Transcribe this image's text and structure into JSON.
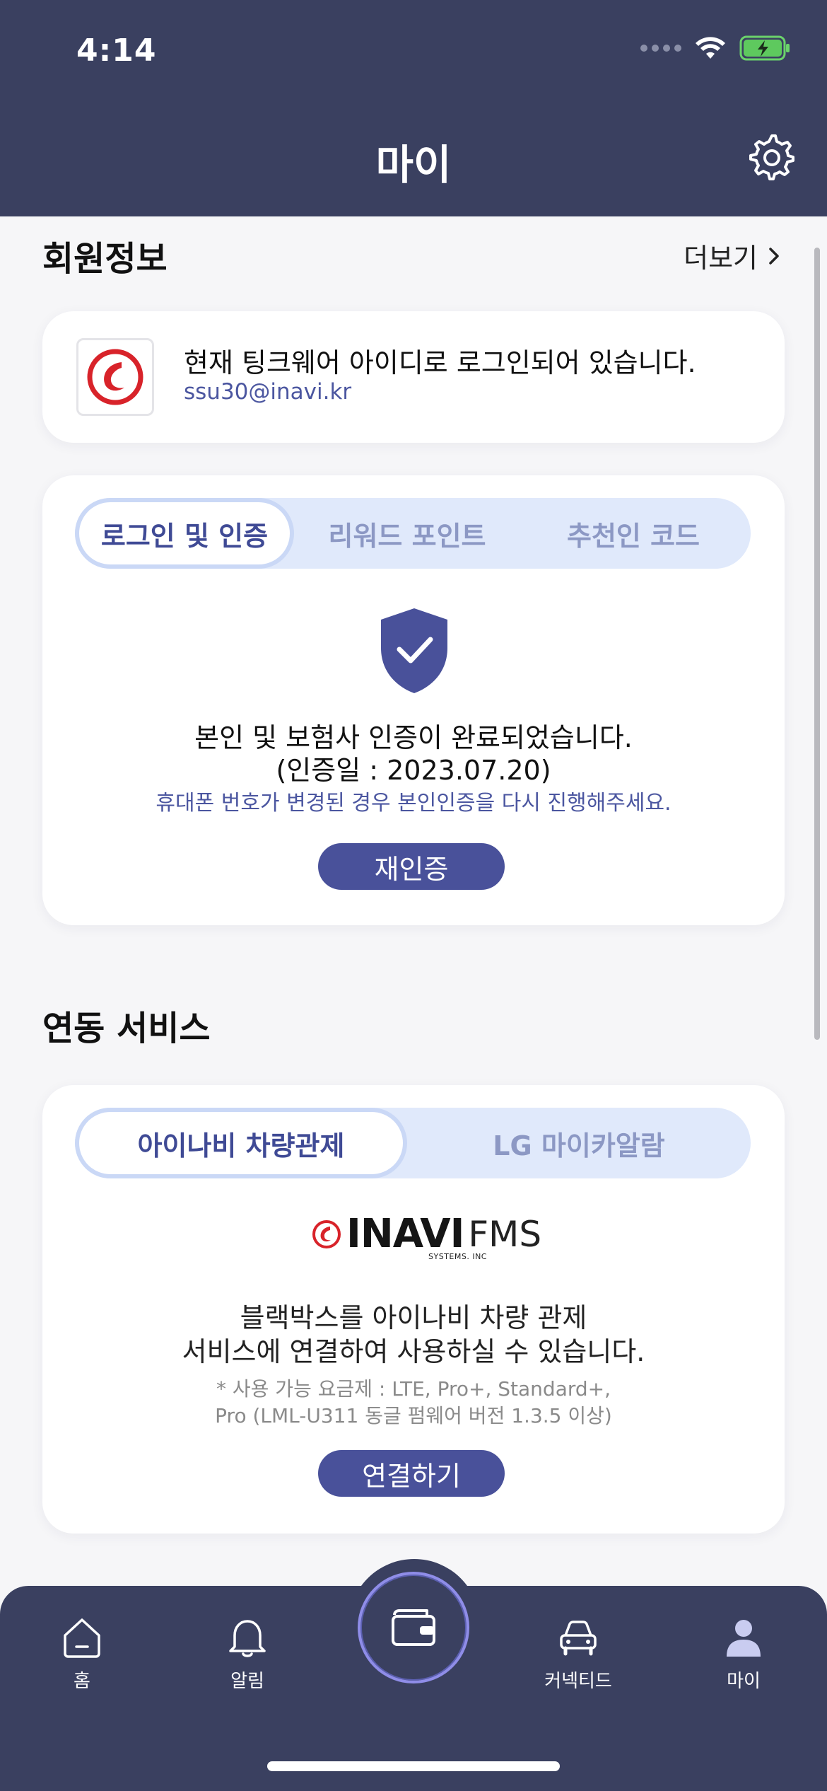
{
  "status_bar": {
    "time": "4:14"
  },
  "header": {
    "title": "마이"
  },
  "member_section": {
    "title": "회원정보",
    "more_label": "더보기",
    "login_text": "현재 팅크웨어 아이디로 로그인되어 있습니다.",
    "email": "ssu30@inavi.kr"
  },
  "auth_card": {
    "tabs": [
      {
        "label": "로그인 및 인증",
        "active": true
      },
      {
        "label": "리워드 포인트",
        "active": false
      },
      {
        "label": "추천인 코드",
        "active": false
      }
    ],
    "message": "본인 및 보험사 인증이 완료되었습니다.",
    "date_text": "(인증일 : 2023.07.20)",
    "hint": "휴대폰 번호가 변경된 경우 본인인증을 다시 진행해주세요.",
    "button_label": "재인증"
  },
  "link_section": {
    "title": "연동 서비스",
    "tabs": [
      {
        "label": "아이나비 차량관제",
        "active": true
      },
      {
        "label": "LG 마이카알람",
        "active": false
      }
    ],
    "logo_brand": "INAVI",
    "logo_suffix": "FMS",
    "logo_sub": "SYSTEMS. INC",
    "desc_line1": "블랙박스를 아이나비 차량 관제",
    "desc_line2": "서비스에 연결하여 사용하실 수 있습니다.",
    "note_line1": "* 사용 가능 요금제 : LTE, Pro+, Standard+,",
    "note_line2": "Pro (LML-U311 동글 펌웨어 버전 1.3.5 이상)",
    "button_label": "연결하기"
  },
  "bottom_nav": {
    "items": [
      {
        "label": "홈",
        "icon": "home-icon"
      },
      {
        "label": "알림",
        "icon": "bell-icon"
      },
      {
        "label": "커넥티드",
        "icon": "car-icon"
      },
      {
        "label": "마이",
        "icon": "person-icon"
      }
    ],
    "center_icon": "wallet-icon"
  },
  "colors": {
    "header_bg": "#3a4060",
    "accent": "#49519a",
    "segment_bg": "#e0e9fb",
    "link_text": "#4b56a0"
  }
}
